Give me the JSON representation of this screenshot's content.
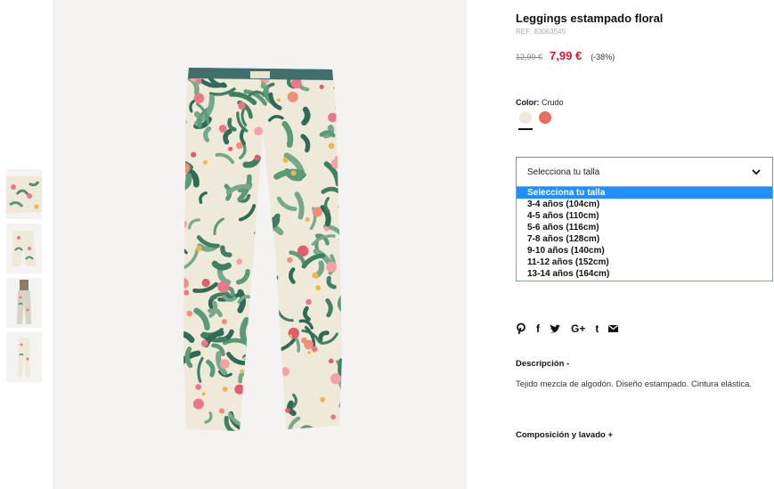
{
  "product": {
    "title": "Leggings estampado floral",
    "ref": "REF: 83063545",
    "old_price": "12,99 €",
    "new_price": "7,99 €",
    "discount": "(-38%)"
  },
  "color": {
    "label": "Color:",
    "value": "Crudo",
    "swatches": [
      {
        "name": "Crudo",
        "hex": "#efe9da",
        "selected": true
      },
      {
        "name": "Coral",
        "hex": "#ec6d5f",
        "selected": false
      }
    ]
  },
  "size_select": {
    "current": "Selecciona tu talla",
    "options": [
      "Selecciona tu talla",
      "3-4 años (104cm)",
      "4-5 años (110cm)",
      "5-6 años (116cm)",
      "7-8 años (128cm)",
      "9-10 años (140cm)",
      "11-12 años (152cm)",
      "13-14 años (164cm)"
    ],
    "highlighted_index": 0
  },
  "share": {
    "icons": [
      "pinterest-icon",
      "facebook-icon",
      "twitter-icon",
      "google-plus-icon",
      "tumblr-icon",
      "email-icon"
    ],
    "gplus_text": "G+",
    "tumblr_text": "t",
    "facebook_text": "f"
  },
  "description": {
    "heading": "Descripción  -",
    "text": "Tejido mezcla de algodón. Diseño estampado. Cintura elástica."
  },
  "composition": {
    "heading": "Composición y lavado  +"
  },
  "thumbnails": {
    "count": 4,
    "selected_index": 0
  }
}
